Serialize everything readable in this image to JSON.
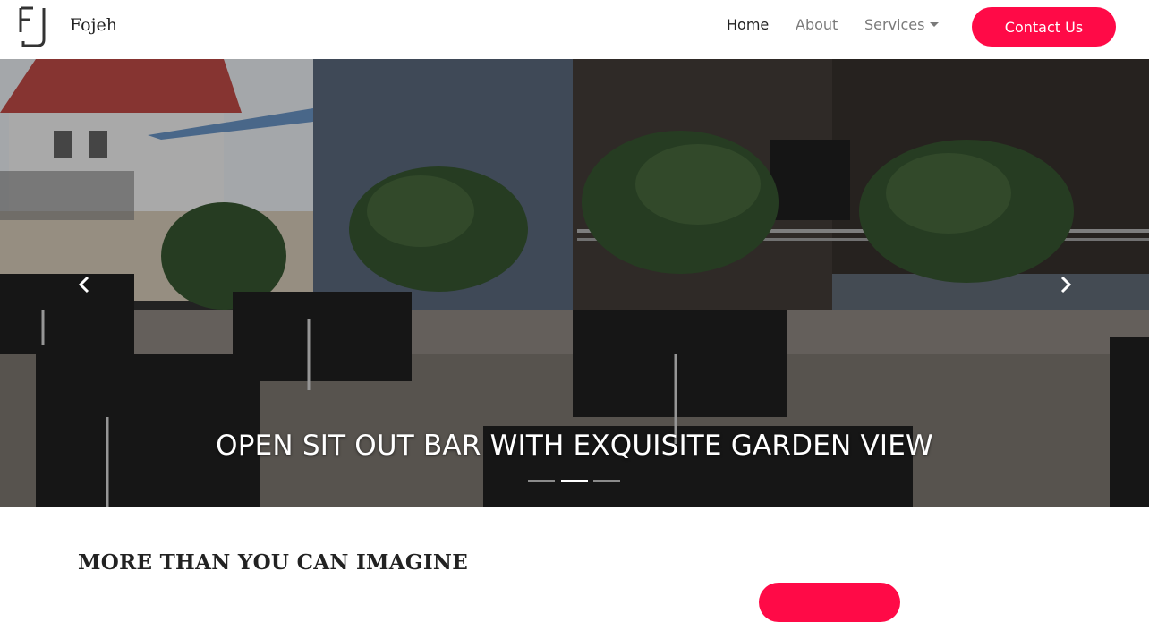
{
  "brand": {
    "name": "Fojeh"
  },
  "nav": {
    "home": "Home",
    "about": "About",
    "services": "Services",
    "contact": "Contact Us"
  },
  "hero": {
    "caption": "OPEN SIT OUT BAR WITH EXQUISITE GARDEN VIEW",
    "active_slide": 2,
    "slide_count": 3
  },
  "intro": {
    "title": "MORE THAN YOU CAN IMAGINE",
    "text": ""
  },
  "colors": {
    "accent": "#ff0a47",
    "nav_active": "#222222",
    "nav_inactive": "#7a7a7a"
  },
  "icons": [
    "logo-mark",
    "chevron-left-icon",
    "chevron-right-icon",
    "caret-down-icon"
  ]
}
